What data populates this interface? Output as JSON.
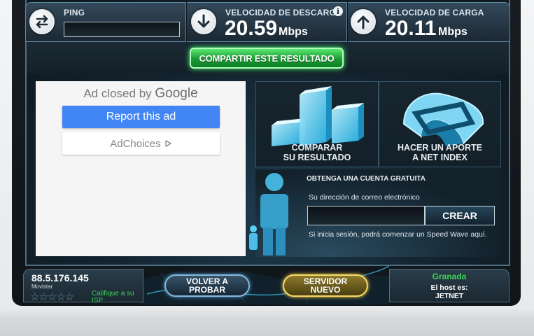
{
  "header": {
    "ping_label": "PING",
    "ping_value": "",
    "download_label": "VELOCIDAD DE DESCARGA",
    "download_value": "20.59",
    "download_unit": "Mbps",
    "upload_label": "VELOCIDAD DE CARGA",
    "upload_value": "20.11",
    "upload_unit": "Mbps",
    "info_glyph": "i"
  },
  "share": {
    "label": "COMPARTIR ESTE RESULTADO"
  },
  "ad": {
    "closed_prefix": "Ad closed by",
    "closed_brand": "Google",
    "report_label": "Report this ad",
    "adchoices_label": "AdChoices"
  },
  "panels": {
    "compare_line1": "COMPARAR",
    "compare_line2": "SU RESULTADO",
    "contribute_line1": "HACER UN APORTE",
    "contribute_line2": "A NET INDEX"
  },
  "account": {
    "title": "OBTENGA UNA CUENTA GRATUITA",
    "email_label": "Su dirección de correo electrónico",
    "email_placeholder": "",
    "create_label": "CREAR",
    "note": "Si inicia sesión, podrá comenzar un Speed Wave aquí."
  },
  "footer": {
    "ip": "88.5.176.145",
    "isp": "Movistar",
    "stars": "☆☆☆☆☆",
    "rate_line1": "Califique a su",
    "rate_line2": "ISP",
    "back_line1": "VOLVER A",
    "back_line2": "PROBAR",
    "server_line1": "SERVIDOR",
    "server_line2": "NUEVO",
    "city": "Granada",
    "host_label": "El host es:",
    "host_value": "JETNET"
  },
  "colors": {
    "accent_green": "#3ed35a",
    "ad_blue": "#4285f4",
    "frame_dark": "#13202a",
    "gold": "#f7d96b"
  }
}
